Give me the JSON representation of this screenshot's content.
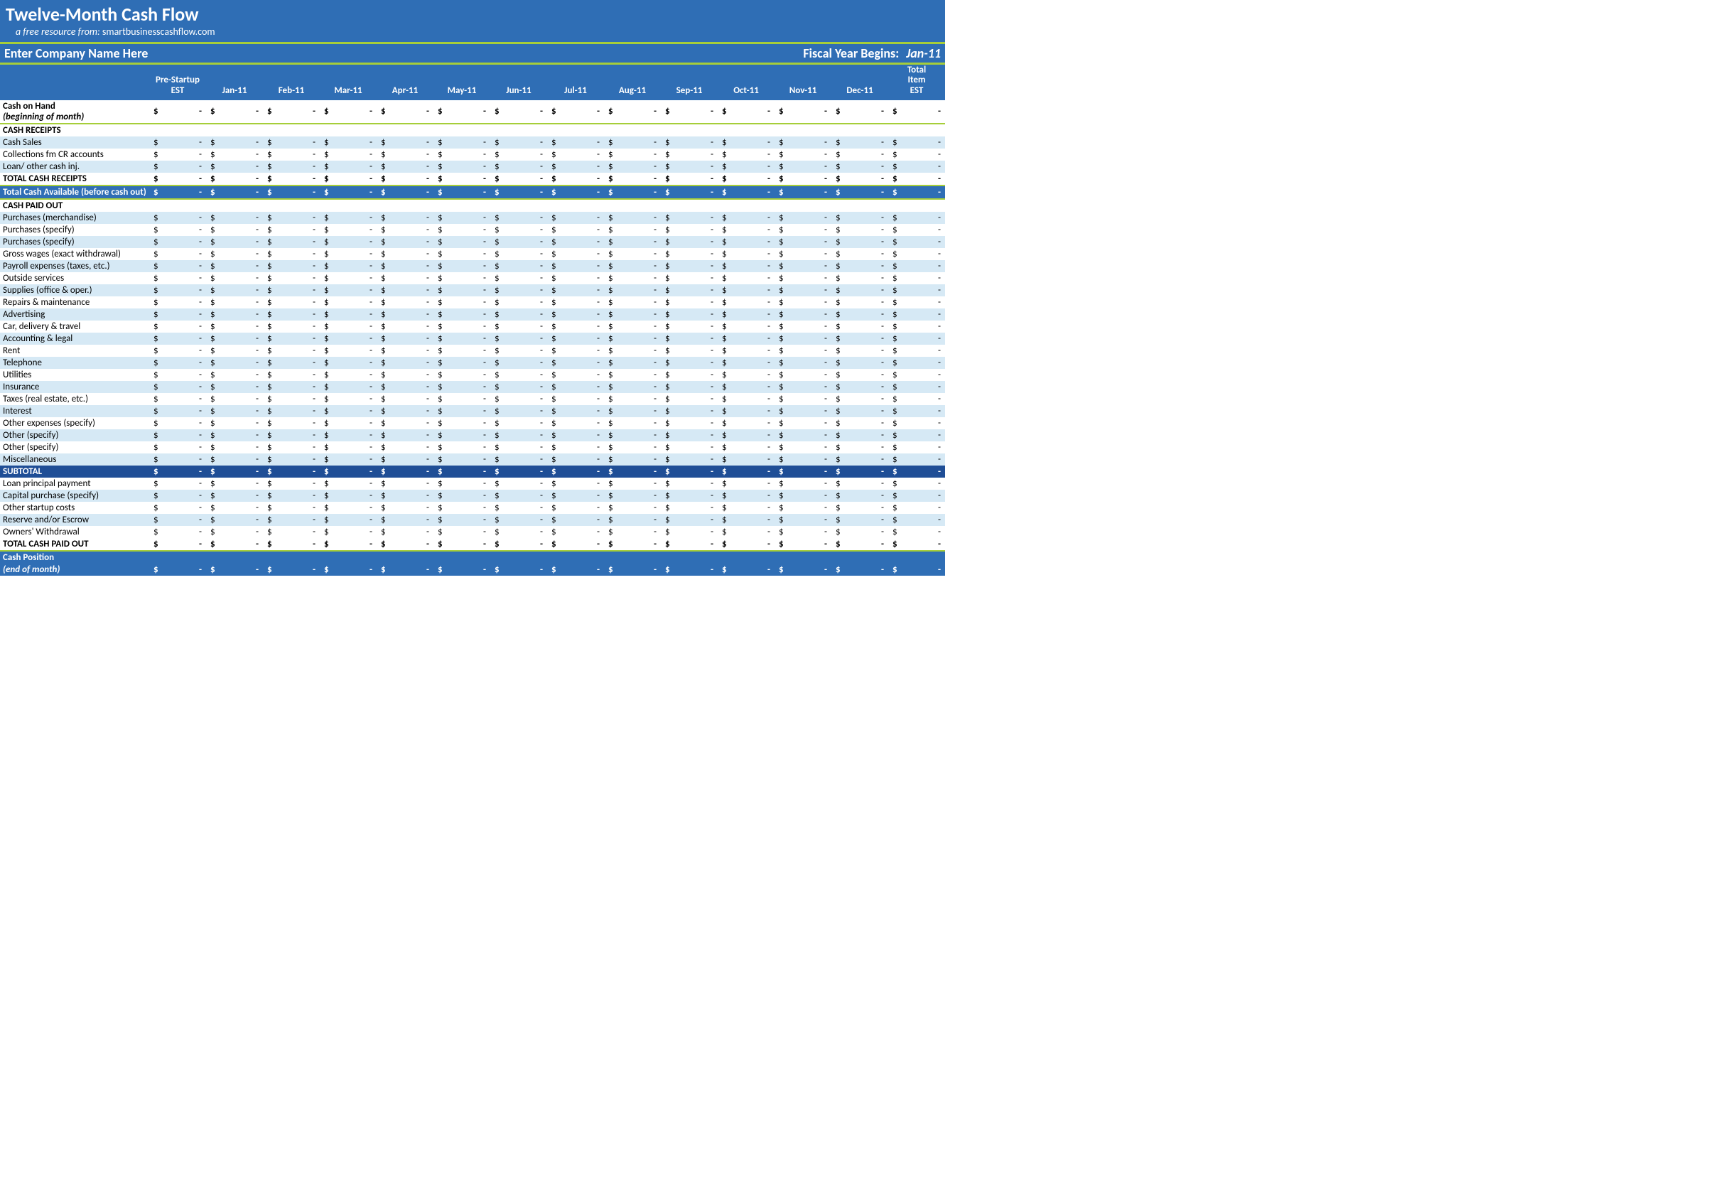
{
  "title": "Twelve-Month Cash Flow",
  "subtitle_prefix": "a free resource from:  ",
  "subtitle_source": "smartbusinesscashflow.com",
  "company_name": "Enter Company Name Here",
  "fiscal_label": "Fiscal Year Begins:",
  "fiscal_value": "Jan-11",
  "columns": [
    "",
    "Pre-Startup EST",
    "Jan-11",
    "Feb-11",
    "Mar-11",
    "Apr-11",
    "May-11",
    "Jun-11",
    "Jul-11",
    "Aug-11",
    "Sep-11",
    "Oct-11",
    "Nov-11",
    "Dec-11",
    "Total Item EST"
  ],
  "cash_on_hand_label1": "Cash on Hand",
  "cash_on_hand_label2": "(beginning of month)",
  "cash_on_hand_values": [
    "-",
    "-",
    "-",
    "-",
    "-",
    "-",
    "-",
    "-",
    "-",
    "-",
    "-",
    "-",
    "-",
    "-"
  ],
  "sections": [
    {
      "header": "CASH RECEIPTS",
      "rows": [
        {
          "label": "Cash Sales",
          "style": "light",
          "values": [
            "-",
            "-",
            "-",
            "-",
            "-",
            "-",
            "-",
            "-",
            "-",
            "-",
            "-",
            "-",
            "-",
            "-"
          ]
        },
        {
          "label": "Collections fm CR accounts",
          "style": "white",
          "values": [
            "-",
            "-",
            "-",
            "-",
            "-",
            "-",
            "-",
            "-",
            "-",
            "-",
            "-",
            "-",
            "-",
            "-"
          ]
        },
        {
          "label": "Loan/ other cash inj.",
          "style": "light",
          "values": [
            "-",
            "-",
            "-",
            "-",
            "-",
            "-",
            "-",
            "-",
            "-",
            "-",
            "-",
            "-",
            "-",
            "-"
          ]
        },
        {
          "label": "TOTAL CASH RECEIPTS",
          "style": "total",
          "values": [
            "-",
            "-",
            "-",
            "-",
            "-",
            "-",
            "-",
            "-",
            "-",
            "-",
            "-",
            "-",
            "-",
            "-"
          ]
        }
      ],
      "footer": {
        "label": "Total Cash Available (before cash out)",
        "values": [
          "-",
          "-",
          "-",
          "-",
          "-",
          "-",
          "-",
          "-",
          "-",
          "-",
          "-",
          "-",
          "-",
          "-"
        ]
      }
    },
    {
      "header": "CASH PAID OUT",
      "rows": [
        {
          "label": "Purchases (merchandise)",
          "style": "light",
          "values": [
            "-",
            "-",
            "-",
            "-",
            "-",
            "-",
            "-",
            "-",
            "-",
            "-",
            "-",
            "-",
            "-",
            "-"
          ]
        },
        {
          "label": "Purchases (specify)",
          "style": "white",
          "values": [
            "-",
            "-",
            "-",
            "-",
            "-",
            "-",
            "-",
            "-",
            "-",
            "-",
            "-",
            "-",
            "-",
            "-"
          ]
        },
        {
          "label": "Purchases (specify)",
          "style": "light",
          "values": [
            "-",
            "-",
            "-",
            "-",
            "-",
            "-",
            "-",
            "-",
            "-",
            "-",
            "-",
            "-",
            "-",
            "-"
          ]
        },
        {
          "label": "Gross wages (exact withdrawal)",
          "style": "white",
          "values": [
            "-",
            "-",
            "-",
            "-",
            "-",
            "-",
            "-",
            "-",
            "-",
            "-",
            "-",
            "-",
            "-",
            "-"
          ]
        },
        {
          "label": "Payroll expenses (taxes, etc.)",
          "style": "light",
          "values": [
            "-",
            "-",
            "-",
            "-",
            "-",
            "-",
            "-",
            "-",
            "-",
            "-",
            "-",
            "-",
            "-",
            "-"
          ]
        },
        {
          "label": "Outside services",
          "style": "white",
          "values": [
            "-",
            "-",
            "-",
            "-",
            "-",
            "-",
            "-",
            "-",
            "-",
            "-",
            "-",
            "-",
            "-",
            "-"
          ]
        },
        {
          "label": "Supplies (office & oper.)",
          "style": "light",
          "values": [
            "-",
            "-",
            "-",
            "-",
            "-",
            "-",
            "-",
            "-",
            "-",
            "-",
            "-",
            "-",
            "-",
            "-"
          ]
        },
        {
          "label": "Repairs & maintenance",
          "style": "white",
          "values": [
            "-",
            "-",
            "-",
            "-",
            "-",
            "-",
            "-",
            "-",
            "-",
            "-",
            "-",
            "-",
            "-",
            "-"
          ]
        },
        {
          "label": "Advertising",
          "style": "light",
          "values": [
            "-",
            "-",
            "-",
            "-",
            "-",
            "-",
            "-",
            "-",
            "-",
            "-",
            "-",
            "-",
            "-",
            "-"
          ]
        },
        {
          "label": "Car, delivery & travel",
          "style": "white",
          "values": [
            "-",
            "-",
            "-",
            "-",
            "-",
            "-",
            "-",
            "-",
            "-",
            "-",
            "-",
            "-",
            "-",
            "-"
          ]
        },
        {
          "label": "Accounting & legal",
          "style": "light",
          "values": [
            "-",
            "-",
            "-",
            "-",
            "-",
            "-",
            "-",
            "-",
            "-",
            "-",
            "-",
            "-",
            "-",
            "-"
          ]
        },
        {
          "label": "Rent",
          "style": "white",
          "values": [
            "-",
            "-",
            "-",
            "-",
            "-",
            "-",
            "-",
            "-",
            "-",
            "-",
            "-",
            "-",
            "-",
            "-"
          ]
        },
        {
          "label": "Telephone",
          "style": "light",
          "values": [
            "-",
            "-",
            "-",
            "-",
            "-",
            "-",
            "-",
            "-",
            "-",
            "-",
            "-",
            "-",
            "-",
            "-"
          ]
        },
        {
          "label": "Utilities",
          "style": "white",
          "values": [
            "-",
            "-",
            "-",
            "-",
            "-",
            "-",
            "-",
            "-",
            "-",
            "-",
            "-",
            "-",
            "-",
            "-"
          ]
        },
        {
          "label": "Insurance",
          "style": "light",
          "values": [
            "-",
            "-",
            "-",
            "-",
            "-",
            "-",
            "-",
            "-",
            "-",
            "-",
            "-",
            "-",
            "-",
            "-"
          ]
        },
        {
          "label": "Taxes (real estate, etc.)",
          "style": "white",
          "values": [
            "-",
            "-",
            "-",
            "-",
            "-",
            "-",
            "-",
            "-",
            "-",
            "-",
            "-",
            "-",
            "-",
            "-"
          ]
        },
        {
          "label": "Interest",
          "style": "light",
          "values": [
            "-",
            "-",
            "-",
            "-",
            "-",
            "-",
            "-",
            "-",
            "-",
            "-",
            "-",
            "-",
            "-",
            "-"
          ]
        },
        {
          "label": "Other expenses (specify)",
          "style": "white",
          "values": [
            "-",
            "-",
            "-",
            "-",
            "-",
            "-",
            "-",
            "-",
            "-",
            "-",
            "-",
            "-",
            "-",
            "-"
          ]
        },
        {
          "label": "Other (specify)",
          "style": "light",
          "values": [
            "-",
            "-",
            "-",
            "-",
            "-",
            "-",
            "-",
            "-",
            "-",
            "-",
            "-",
            "-",
            "-",
            "-"
          ]
        },
        {
          "label": "Other (specify)",
          "style": "white",
          "values": [
            "-",
            "-",
            "-",
            "-",
            "-",
            "-",
            "-",
            "-",
            "-",
            "-",
            "-",
            "-",
            "-",
            "-"
          ]
        },
        {
          "label": "Miscellaneous",
          "style": "light",
          "values": [
            "-",
            "-",
            "-",
            "-",
            "-",
            "-",
            "-",
            "-",
            "-",
            "-",
            "-",
            "-",
            "-",
            "-"
          ]
        }
      ],
      "subtotal": {
        "label": "SUBTOTAL",
        "values": [
          "-",
          "-",
          "-",
          "-",
          "-",
          "-",
          "-",
          "-",
          "-",
          "-",
          "-",
          "-",
          "-",
          "-"
        ]
      },
      "postrows": [
        {
          "label": "Loan principal payment",
          "style": "white",
          "values": [
            "-",
            "-",
            "-",
            "-",
            "-",
            "-",
            "-",
            "-",
            "-",
            "-",
            "-",
            "-",
            "-",
            "-"
          ]
        },
        {
          "label": "Capital purchase (specify)",
          "style": "light",
          "values": [
            "-",
            "-",
            "-",
            "-",
            "-",
            "-",
            "-",
            "-",
            "-",
            "-",
            "-",
            "-",
            "-",
            "-"
          ]
        },
        {
          "label": "Other startup costs",
          "style": "white",
          "values": [
            "-",
            "-",
            "-",
            "-",
            "-",
            "-",
            "-",
            "-",
            "-",
            "-",
            "-",
            "-",
            "-",
            "-"
          ]
        },
        {
          "label": "Reserve and/or Escrow",
          "style": "light",
          "values": [
            "-",
            "-",
            "-",
            "-",
            "-",
            "-",
            "-",
            "-",
            "-",
            "-",
            "-",
            "-",
            "-",
            "-"
          ]
        },
        {
          "label": "Owners' Withdrawal",
          "style": "white",
          "values": [
            "-",
            "-",
            "-",
            "-",
            "-",
            "-",
            "-",
            "-",
            "-",
            "-",
            "-",
            "-",
            "-",
            "-"
          ]
        },
        {
          "label": "TOTAL CASH PAID OUT",
          "style": "total",
          "values": [
            "-",
            "-",
            "-",
            "-",
            "-",
            "-",
            "-",
            "-",
            "-",
            "-",
            "-",
            "-",
            "-",
            "-"
          ]
        }
      ]
    }
  ],
  "cash_position_label1": "Cash Position",
  "cash_position_label2": "(end of month)",
  "cash_position_values": [
    "-",
    "-",
    "-",
    "-",
    "-",
    "-",
    "-",
    "-",
    "-",
    "-",
    "-",
    "-",
    "-",
    "-"
  ],
  "currency_symbol": "$"
}
